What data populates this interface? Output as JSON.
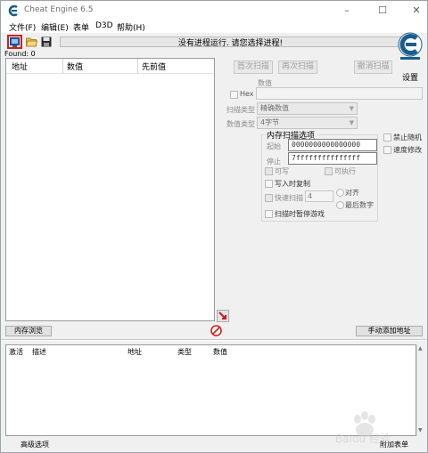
{
  "window": {
    "title": "Cheat Engine 6.5",
    "controls": [
      "–",
      "☐",
      "✕"
    ]
  },
  "menu": [
    {
      "label": "文件(F)"
    },
    {
      "label": "编辑(E)"
    },
    {
      "label": "表单"
    },
    {
      "label": "D3D"
    },
    {
      "label": "帮助(H)"
    }
  ],
  "process": {
    "status_text": "没有进程运行. 请您选择进程!"
  },
  "found": "Found: 0",
  "results": {
    "headers": [
      "地址",
      "数值",
      "先前值"
    ]
  },
  "scan": {
    "first_scan": "首次扫描",
    "next_scan": "再次扫描",
    "undo_scan": "撤消扫描",
    "value_label": "数值",
    "hex_label": "Hex",
    "scan_type_label": "扫描类型",
    "scan_type_value": "精确数值",
    "value_type_label": "数值类型",
    "value_type_value": "4字节",
    "settings_label": "设置"
  },
  "memory_options": {
    "title": "内存扫描选项",
    "start_label": "起始",
    "start_value": "0000000000000000",
    "stop_label": "停止",
    "stop_value": "7fffffffffffffff",
    "writable": "可写",
    "executable": "可执行",
    "copy_on_write": "写入时复制",
    "fast_scan": "快速扫描",
    "fast_scan_value": "4",
    "align": "对齐",
    "last_digits": "最后数字",
    "pause_game": "扫描时暂停游戏"
  },
  "extra_options": {
    "unrandomizer": "禁止随机",
    "speedhack": "速度修改"
  },
  "buttons": {
    "memory_view": "内存浏览",
    "add_address": "手动添加地址"
  },
  "address_list": {
    "headers": [
      "激活",
      "描述",
      "地址",
      "类型",
      "数值"
    ]
  },
  "status": {
    "advanced": "高级选项",
    "table_extras": "附加表单"
  },
  "watermark": "Baidu 经验",
  "colors": {
    "icon_blue": "#1a5d8a",
    "highlight_red": "#d02020",
    "window_bg": "#f0f0f0"
  }
}
